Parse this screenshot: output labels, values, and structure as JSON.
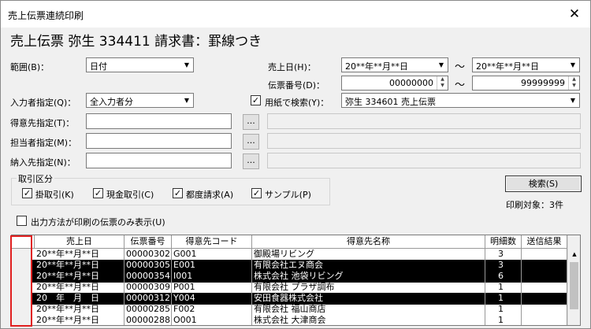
{
  "window": {
    "title": "売上伝票連続印刷",
    "close": "✕"
  },
  "heading": "売上伝票 弥生 334411 請求書：罫線つき",
  "range": {
    "label": "範囲(B)：",
    "value": "日付"
  },
  "sales_date": {
    "label": "売上日(H)：",
    "from": "20**年**月**日",
    "to": "20**年**月**日",
    "tilde": "～"
  },
  "slip_no": {
    "label": "伝票番号(D)：",
    "from": "00000000",
    "to": "99999999",
    "tilde": "～"
  },
  "inputter": {
    "label": "入力者指定(Q)：",
    "value": "全入力者分"
  },
  "paper_search": {
    "label": "用紙で検索(Y)：",
    "checked": "✓",
    "value": "弥生 334601 売上伝票"
  },
  "customer": {
    "label": "得意先指定(T)：",
    "btn": "..."
  },
  "staff": {
    "label": "担当者指定(M)：",
    "btn": "..."
  },
  "delivery": {
    "label": "納入先指定(N)：",
    "btn": "..."
  },
  "tx_group": {
    "label": "取引区分",
    "items": [
      {
        "label": "掛取引(K)",
        "check": "✓"
      },
      {
        "label": "現金取引(C)",
        "check": "✓"
      },
      {
        "label": "都度請求(A)",
        "check": "✓"
      },
      {
        "label": "サンプル(P)",
        "check": "✓"
      }
    ]
  },
  "search_button": "検索(S)",
  "print_target": "印刷対象：3件",
  "only_paper": {
    "label": "出力方法が印刷の伝票のみ表示(U)",
    "check": ""
  },
  "table": {
    "headers": [
      "売上日",
      "伝票番号",
      "得意先コード",
      "得意先名称",
      "明細数",
      "送信結果"
    ],
    "rows": [
      {
        "date": "20**年**月**日",
        "no": "00000302",
        "code": "G001",
        "name": "御殿場リビング",
        "count": "3",
        "sel": false
      },
      {
        "date": "20**年**月**日",
        "no": "00000305",
        "code": "E001",
        "name": "有限会社エヌ商会",
        "count": "3",
        "sel": true
      },
      {
        "date": "20**年**月**日",
        "no": "00000354",
        "code": "I001",
        "name": "株式会社 池袋リビング",
        "count": "6",
        "sel": true
      },
      {
        "date": "20**年**月**日",
        "no": "00000309",
        "code": "P001",
        "name": "有限会社 プラザ調布",
        "count": "1",
        "sel": false
      },
      {
        "date": "20　年　月　日",
        "no": "00000312",
        "code": "Y004",
        "name": "安田食器株式会社",
        "count": "1",
        "sel": true
      },
      {
        "date": "20**年**月**日",
        "no": "00000285",
        "code": "F002",
        "name": "有限会社 福山商店",
        "count": "1",
        "sel": false
      },
      {
        "date": "20**年**月**日",
        "no": "00000288",
        "code": "O001",
        "name": "株式会社 大津商会",
        "count": "1",
        "sel": false
      }
    ]
  },
  "colors": {
    "highlight": "#e02020",
    "selected_row": "#000000"
  }
}
